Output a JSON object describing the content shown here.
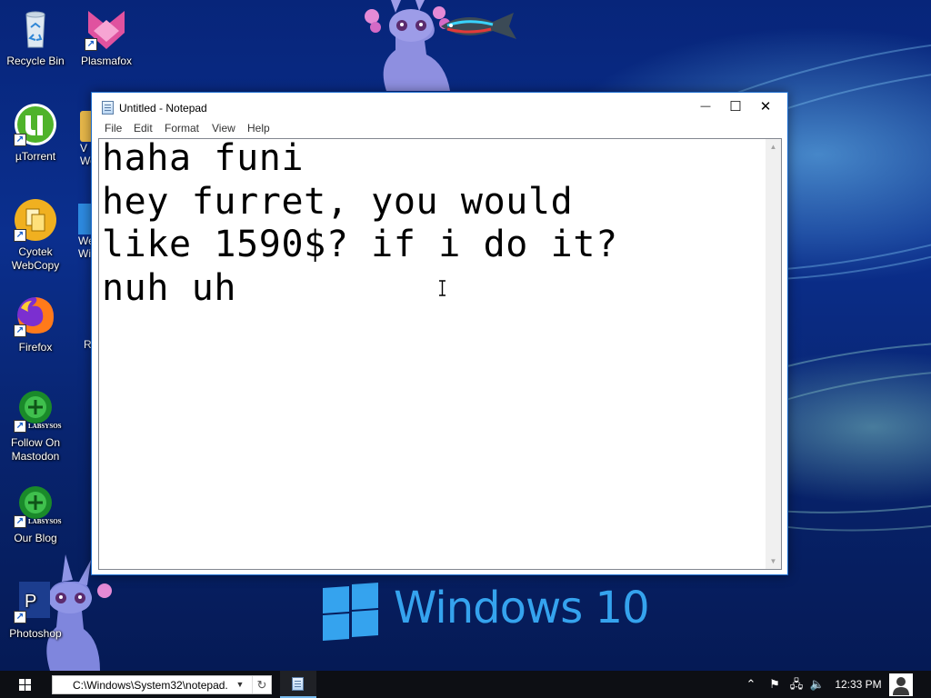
{
  "desktop": {
    "icons": [
      {
        "label": "Recycle Bin",
        "icon": "recycle-bin-icon"
      },
      {
        "label": "Plasmafox",
        "icon": "plasmafox-icon"
      },
      {
        "label": "µTorrent",
        "icon": "utorrent-icon"
      },
      {
        "label": "Cyotek WebCopy",
        "icon": "webcopy-icon"
      },
      {
        "label": "Firefox",
        "icon": "firefox-icon"
      },
      {
        "label": "Follow On Mastodon",
        "icon": "mastodon-icon"
      },
      {
        "label": "Our Blog",
        "icon": "blog-icon"
      },
      {
        "label": "Photoshop",
        "icon": "photoshop-icon"
      }
    ],
    "partial_icons": [
      "V We",
      "We Wi",
      "R"
    ],
    "badge_text": "LABSYSOS",
    "wallpaper_brand": "Windows 10"
  },
  "notepad": {
    "title": "Untitled - Notepad",
    "menu": [
      "File",
      "Edit",
      "Format",
      "View",
      "Help"
    ],
    "content": "haha funi\nhey furret, you would\nlike 1590$? if i do it?\nnuh uh",
    "buttons": {
      "minimize": "—",
      "maximize": "☐",
      "close": "✕"
    }
  },
  "taskbar": {
    "run_value": "C:\\Windows\\System32\\notepad.",
    "clock": "12:33 PM"
  },
  "colors": {
    "accent": "#35a3ee",
    "window_border": "#1f6fd0",
    "taskbar": "#0d0f14"
  }
}
